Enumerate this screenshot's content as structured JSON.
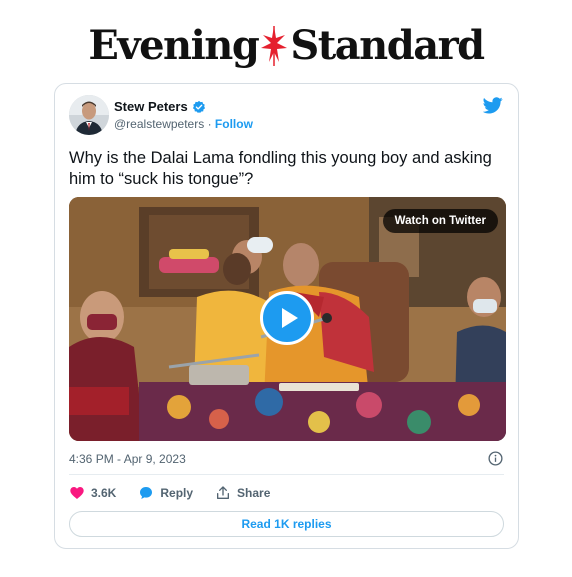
{
  "masthead": {
    "brand_left": "Evening",
    "brand_right": "Standard"
  },
  "tweet": {
    "author_name": "Stew Peters",
    "handle": "@realstewpeters",
    "separator": "·",
    "follow_label": "Follow",
    "text": "Why is the Dalai Lama fondling this young boy and asking him to “suck his tongue”?",
    "watch_label": "Watch on Twitter",
    "timestamp": "4:36 PM - Apr 9, 2023",
    "like_count": "3.6K",
    "reply_label": "Reply",
    "share_label": "Share",
    "read_replies_label": "Read 1K replies"
  },
  "colors": {
    "accent": "#1d9bf0",
    "like": "#f91880",
    "text": "#0f1419",
    "secondary": "#536471",
    "masthead_mark": "#e5202e"
  },
  "icons": {
    "verified": "verified-badge-icon",
    "brand": "twitter-bird-icon",
    "play": "play-icon",
    "info": "info-icon",
    "like": "heart-icon",
    "reply": "speech-bubble-icon",
    "share": "share-icon"
  }
}
